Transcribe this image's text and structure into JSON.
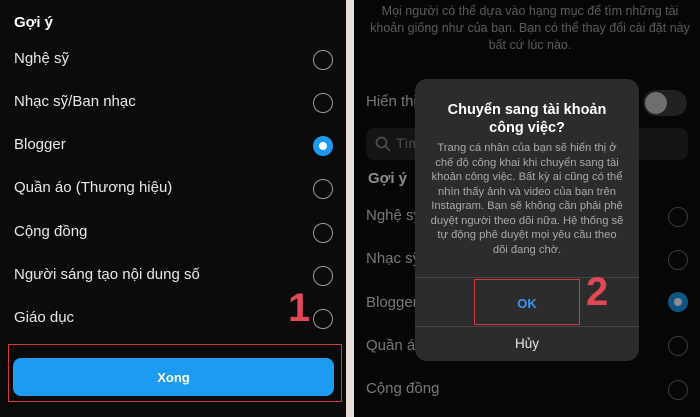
{
  "left": {
    "section_header": "Gợi ý",
    "options": [
      {
        "label": "Nghệ sỹ",
        "selected": false
      },
      {
        "label": "Nhạc sỹ/Ban nhạc",
        "selected": false
      },
      {
        "label": "Blogger",
        "selected": true
      },
      {
        "label": "Quần áo (Thương hiệu)",
        "selected": false
      },
      {
        "label": "Cộng đồng",
        "selected": false
      },
      {
        "label": "Người sáng tạo nội dung số",
        "selected": false
      },
      {
        "label": "Giáo dục",
        "selected": false
      }
    ],
    "done_label": "Xong",
    "step_number": "1"
  },
  "right": {
    "top_description": "Mọi người có thể dựa vào hạng mục để tìm những tài khoản giống như của bạn. Bạn có thể thay đổi cài đặt này bất cứ lúc nào.",
    "display_label_partial": "Hiển thị",
    "search_placeholder_partial": "Tìm",
    "section_header": "Gợi ý",
    "bg_options": [
      "Nghệ sỹ",
      "Nhạc sỹ",
      "Blogger",
      "Quần áo",
      "Cộng đồng"
    ],
    "dialog": {
      "title": "Chuyển sang tài khoản công việc?",
      "body": "Trang cá nhân của bạn sẽ hiển thị ở chế độ công khai khi chuyển sang tài khoản công việc. Bất kỳ ai cũng có thể nhìn thấy ảnh và video của bạn trên Instagram. Bạn sẽ không cần phải phê duyệt người theo dõi nữa. Hệ thống sẽ tự động phê duyệt mọi yêu cầu theo dõi đang chờ.",
      "ok_label": "OK",
      "cancel_label": "Hủy"
    },
    "step_number": "2"
  },
  "colors": {
    "accent": "#1d9bf0",
    "highlight": "#d0393e",
    "step_number": "#e04855",
    "background": "#0b0b0b"
  },
  "icons": {
    "search": "search-icon",
    "radio": "radio-icon"
  }
}
